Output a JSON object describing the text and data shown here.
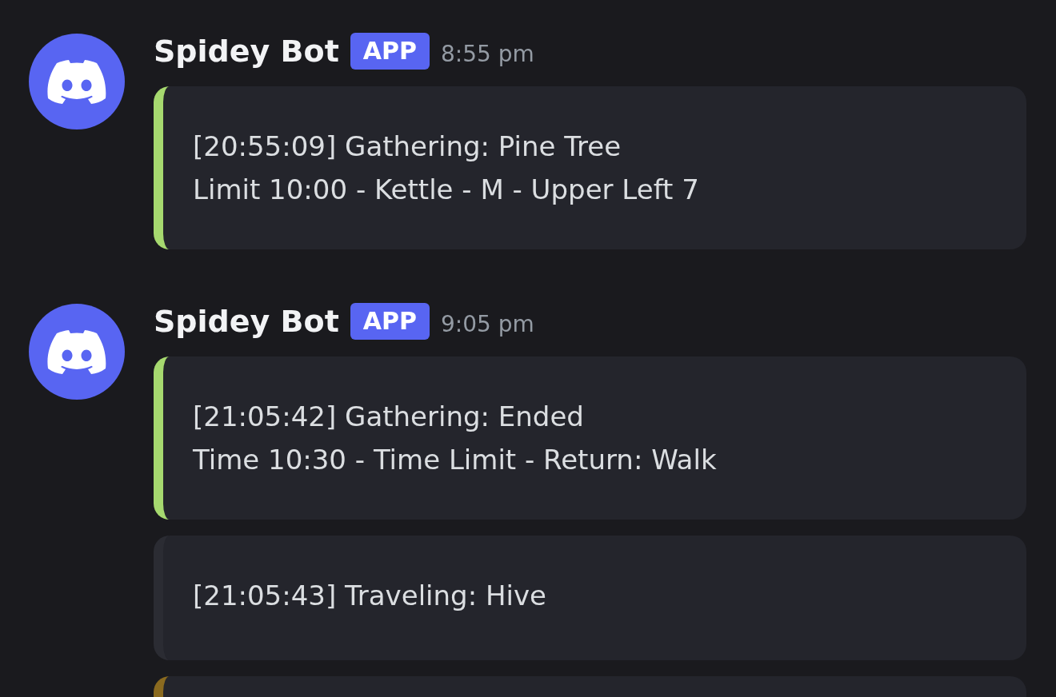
{
  "messages": [
    {
      "author": "Spidey Bot",
      "badge": "APP",
      "time": "8:55 pm",
      "embeds": [
        {
          "color": "#a6d96f",
          "lines": [
            "[20:55:09] Gathering: Pine Tree",
            "Limit 10:00 - Kettle - M - Upper Left 7"
          ]
        }
      ]
    },
    {
      "author": "Spidey Bot",
      "badge": "APP",
      "time": "9:05 pm",
      "embeds": [
        {
          "color": "#a6d96f",
          "lines": [
            "[21:05:42] Gathering: Ended",
            "Time 10:30 - Time Limit - Return: Walk"
          ]
        },
        {
          "color": "#2b2c33",
          "lines": [
            "[21:05:43] Traveling: Hive"
          ]
        },
        {
          "color": "#8a6a1f"
        }
      ]
    }
  ]
}
